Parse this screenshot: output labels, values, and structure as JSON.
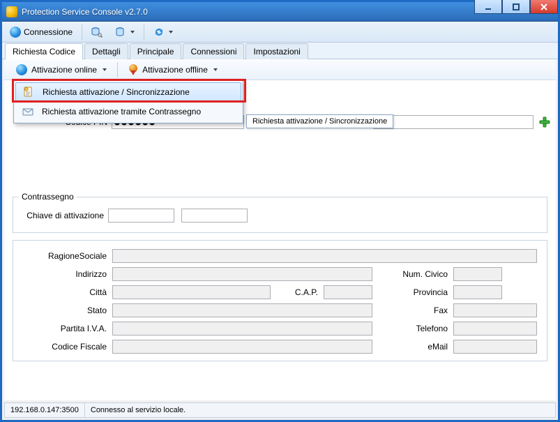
{
  "window": {
    "title": "Protection Service Console v2.7.0"
  },
  "toolbar": {
    "connessione_label": "Connessione"
  },
  "tabs": {
    "richiesta_codice": "Richiesta Codice",
    "dettagli": "Dettagli",
    "principale": "Principale",
    "connessioni": "Connessioni",
    "impostazioni": "Impostazioni"
  },
  "subtoolbar": {
    "attivazione_online": "Attivazione online",
    "attivazione_offline": "Attivazione offline"
  },
  "menu": {
    "item_sync": "Richiesta attivazione / Sincronizzazione",
    "item_contrassegno": "Richiesta attivazione tramite Contrassegno"
  },
  "tooltip": {
    "sync": "Richiesta attivazione / Sincronizzazione"
  },
  "codice": {
    "label": "Codice PIN",
    "value": "●●●●●●"
  },
  "contrassegno": {
    "legend": "Contrassegno",
    "chiave_label": "Chiave di attivazione"
  },
  "company": {
    "ragione_sociale": "RagioneSociale",
    "indirizzo": "Indirizzo",
    "num_civico": "Num. Civico",
    "citta": "Città",
    "cap": "C.A.P.",
    "provincia": "Provincia",
    "stato": "Stato",
    "fax": "Fax",
    "partita_iva": "Partita I.V.A.",
    "telefono": "Telefono",
    "codice_fiscale": "Codice Fiscale",
    "email": "eMail"
  },
  "status": {
    "server": "192.168.0.147:3500",
    "message": "Connesso al servizio locale."
  }
}
